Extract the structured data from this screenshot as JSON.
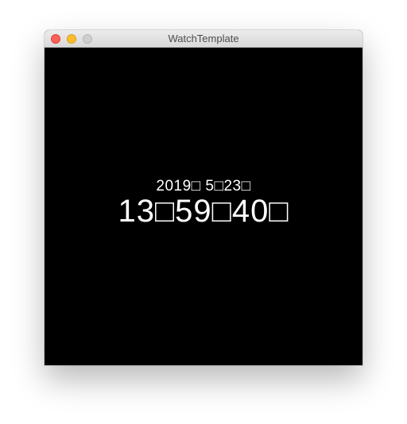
{
  "window": {
    "title": "WatchTemplate"
  },
  "clock": {
    "date": "2019□ 5□23□",
    "time": "13□59□40□"
  },
  "colors": {
    "background": "#000000",
    "text": "#ffffff",
    "close": "#fc5f57",
    "minimize": "#fdbc2e",
    "zoom_disabled": "#cfcfcf"
  }
}
